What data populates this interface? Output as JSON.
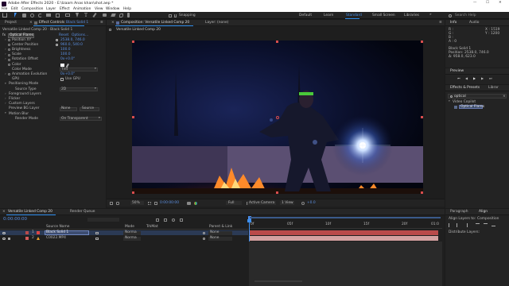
{
  "window": {
    "title": "Adobe After Effects 2020 - E:\\Izaam Anas khan\\shot.aep *",
    "minimize": "—",
    "maximize": "☐",
    "close": "✕"
  },
  "menu": [
    "File",
    "Edit",
    "Composition",
    "Layer",
    "Effect",
    "Animation",
    "View",
    "Window",
    "Help"
  ],
  "toolbar": {
    "snapping": "Snapping",
    "workspaces": [
      "Default",
      "Learn",
      "Standard",
      "Small Screen",
      "Libraries"
    ],
    "workspace_active": "Standard",
    "search_placeholder": "Search Help"
  },
  "project": {
    "tab": "Project",
    "effect_controls_tab": "Effect Controls",
    "effect_controls_layer": "Black Solid 1",
    "header": "Versatile Linked Comp 20 · Black Solid 1",
    "effect_name": "Optical Flares",
    "reset": "Reset",
    "options": "Options...",
    "props": [
      {
        "name": "Position XY",
        "value": "2538.0, 746.0",
        "blue": true,
        "swatch": "#ffffff"
      },
      {
        "name": "Center Position",
        "value": "960.0, 540.0",
        "blue": true,
        "swatch": "#ffffff"
      },
      {
        "name": "Brightness",
        "value": "100.0",
        "blue": true
      },
      {
        "name": "Scale",
        "value": "100.0",
        "blue": true
      },
      {
        "name": "Rotation Offset",
        "value": "0x+0.0°",
        "blue": true
      },
      {
        "name": "Color",
        "value": "",
        "swatch": "#ffffff"
      },
      {
        "name": "Color Mode",
        "value": "Tint",
        "dropdown": true
      },
      {
        "name": "Animation Evolution",
        "value": "0x+0.0°",
        "blue": true
      },
      {
        "name": "GPU",
        "value": "Use GPU",
        "checkbox": true
      },
      {
        "name": "Positioning Mode",
        "value": ""
      },
      {
        "name": "Source Type",
        "value": "2D",
        "dropdown": true,
        "indent": true
      },
      {
        "name": "Foreground Layers",
        "value": ""
      },
      {
        "name": "Flicker",
        "value": ""
      },
      {
        "name": "Custom Layers",
        "value": ""
      },
      {
        "name": "Preview BG Layer",
        "value": "None",
        "dropdown": true,
        "extra": "Source"
      },
      {
        "name": "Motion Blur",
        "value": ""
      },
      {
        "name": "Render Mode",
        "value": "On Transparent",
        "dropdown": true,
        "indent": true
      }
    ]
  },
  "composition": {
    "tab": "Composition: Versatile Linked Comp 20",
    "layer_tab": "Layer: (none)",
    "breadcrumb": "Versatile Linked Comp 20",
    "footer": {
      "zoom": "50%",
      "timecode": "0:00:00:00",
      "resolution": "Full",
      "camera": "Active Camera",
      "views": "1 View",
      "exposure": "+0.0"
    }
  },
  "info": {
    "tabs": [
      "Info",
      "Audio"
    ],
    "rgba": [
      "R :",
      "G :",
      "B :",
      "A : 0"
    ],
    "xy": [
      "X : 1519",
      "Y : 1200"
    ],
    "layer_name": "Black Solid 1",
    "position": "Position: 2538.0, 746.0",
    "delta": "Δ: 958.0, 623.0"
  },
  "preview": {
    "tab": "Preview"
  },
  "effects_presets": {
    "tab": "Effects & Presets",
    "tab2": "Librar",
    "search": "optical",
    "category": "Video Copilot",
    "item": "Optical Flares"
  },
  "timeline": {
    "tabs": [
      "Versatile Linked Comp 20",
      "Render Queue"
    ],
    "timecode": "0:00:00:00",
    "columns": {
      "name": "Source Name",
      "mode": "Mode",
      "trkmat": "TrkMat",
      "parent": "Parent & Link"
    },
    "layers": [
      {
        "num": "1",
        "name": "Black Solid 1",
        "mode": "Norma",
        "parent": "None",
        "color": "#b94a4a",
        "selected": true
      },
      {
        "num": "2",
        "name": "C0022.MP4",
        "mode": "Norma",
        "parent": "None",
        "color": "#d35a5a",
        "selected": false
      }
    ],
    "ruler": [
      "0f",
      "05f",
      "10f",
      "15f",
      "20f",
      "01:0"
    ],
    "toggle": "Toggle Switches / Modes"
  },
  "paragraph": {
    "tabs": [
      "Paragraph",
      "Align"
    ],
    "align_to": "Align Layers to:",
    "align_value": "Composition",
    "distribute": "Distribute Layers:"
  },
  "colors": {
    "accent": "#2d8ceb",
    "bar_red": "#b94a4a",
    "bar_light": "#d3a0a0",
    "fire": "#ff8a2a",
    "headband": "#49c93a"
  }
}
